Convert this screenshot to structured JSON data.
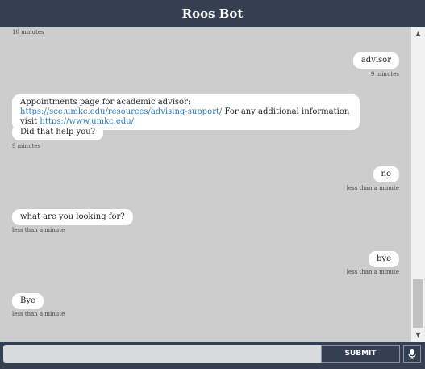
{
  "header": {
    "title": "Roos Bot"
  },
  "messages": [
    {
      "sender": "bot",
      "timestamp": "10 minutes"
    },
    {
      "sender": "user",
      "text": "advisor",
      "timestamp": "9 minutes"
    },
    {
      "sender": "bot",
      "text_before": "Appointments page for academic advisor: ",
      "link1": "https://sce.umkc.edu/resources/advising-support/",
      "text_middle": " For any additional information visit ",
      "link2": "https://www.umkc.edu/"
    },
    {
      "sender": "bot",
      "text": "Did that help you?",
      "timestamp": "9 minutes"
    },
    {
      "sender": "user",
      "text": "no",
      "timestamp": "less than a minute"
    },
    {
      "sender": "bot",
      "text": "what are you looking for?",
      "timestamp": "less than a minute"
    },
    {
      "sender": "user",
      "text": "bye",
      "timestamp": "less than a minute"
    },
    {
      "sender": "bot",
      "text": "Bye",
      "timestamp": "less than a minute"
    }
  ],
  "input": {
    "placeholder": "",
    "value": ""
  },
  "submit_label": "SUBMIT",
  "icons": {
    "mic": "microphone-icon",
    "scroll_up": "scroll-up-arrow-icon",
    "scroll_down": "scroll-down-arrow-icon"
  }
}
